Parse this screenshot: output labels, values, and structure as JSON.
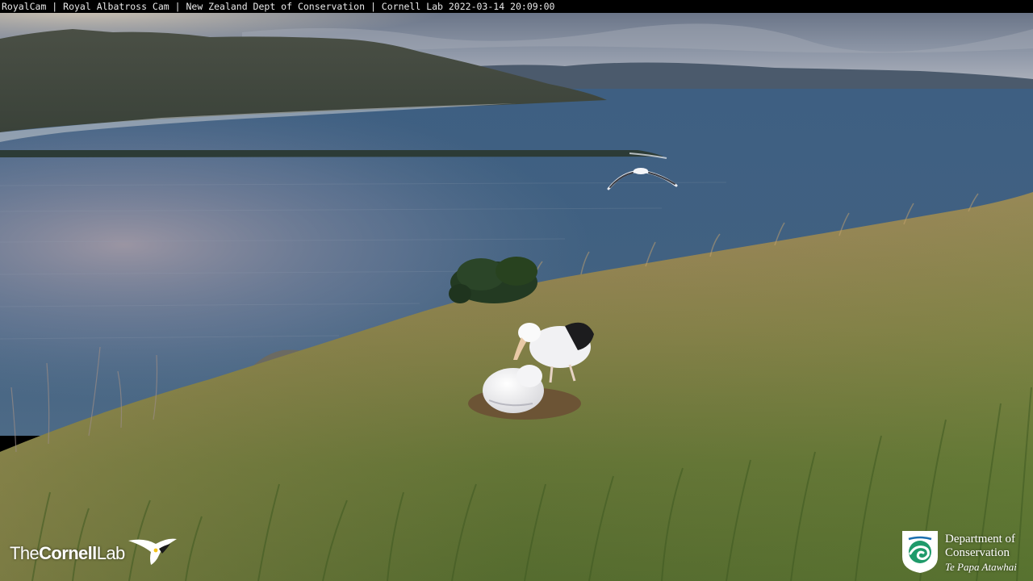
{
  "stream": {
    "title_bar": "RoyalCam | Royal Albatross Cam | New Zealand Dept of Conservation | Cornell Lab 2022-03-14 20:09:00"
  },
  "overlays": {
    "cornell_logo": {
      "word1": "The",
      "word2": "Cornell",
      "word3": "Lab",
      "icon": "bird-in-flight-icon"
    },
    "doc_logo": {
      "line1": "Department of",
      "line2": "Conservation",
      "line3": "Te Papa Atawhai",
      "icon": "doc-wave-shield-icon"
    }
  },
  "scene": {
    "subjects": [
      "albatross-adult",
      "albatross-chick",
      "albatross-in-flight"
    ],
    "colors": {
      "sky": "#8a93a3",
      "water": "#3f5f80",
      "grass": "#6a7a36",
      "dry_grass": "#a8875a"
    }
  }
}
